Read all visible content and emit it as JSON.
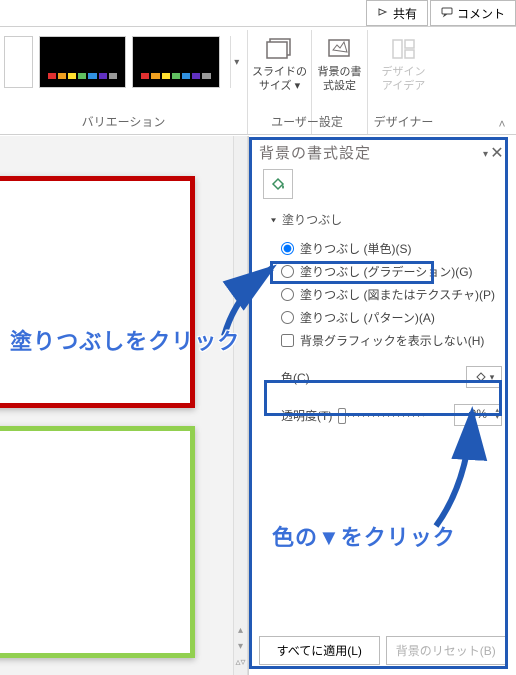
{
  "titlebar": {
    "share_label": "共有",
    "comment_label": "コメント"
  },
  "ribbon": {
    "variations_label": "バリエーション",
    "slide_size_label": "スライドの\nサイズ ▾",
    "format_bg_label": "背景の書\n式設定",
    "customize_group_label": "ユーザー設定",
    "design_ideas_label": "デザイン\nアイデア",
    "designer_group_label": "デザイナー",
    "thumb_colors": [
      "#e03030",
      "#f0a020",
      "#ffe030",
      "#60c060",
      "#3090e0",
      "#6030c0",
      "#999999"
    ]
  },
  "pane": {
    "title": "背景の書式設定",
    "section_fill": "塗りつぶし",
    "fill_solid": "塗りつぶし (単色)(S)",
    "fill_gradient": "塗りつぶし (グラデーション)(G)",
    "fill_picture": "塗りつぶし (図またはテクスチャ)(P)",
    "fill_pattern": "塗りつぶし (パターン)(A)",
    "hide_bg_graphics": "背景グラフィックを表示しない(H)",
    "color_label": "色(C)",
    "transparency_label": "透明度(T)",
    "transparency_value": "0%",
    "apply_all": "すべてに適用(L)",
    "reset_bg": "背景のリセット(B)"
  },
  "annotations": {
    "callout_fill": "塗りつぶしをクリック",
    "callout_color": "色の▼をクリック"
  }
}
